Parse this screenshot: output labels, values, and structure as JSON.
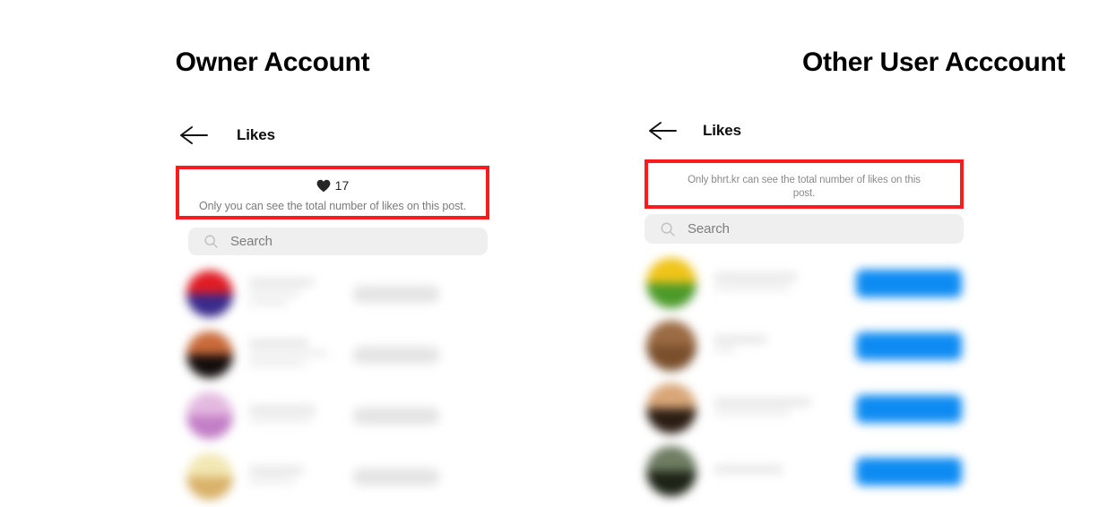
{
  "panels": [
    {
      "id": "owner",
      "section_title": "Owner Account",
      "nav": {
        "back_icon": "arrow-left-icon",
        "title": "Likes"
      },
      "highlight": {
        "heart_icon": "heart-filled-icon",
        "like_count": "17",
        "privacy_note": "Only you can see the total number of likes on this post.",
        "border_color": "#fb1b1b"
      },
      "search": {
        "icon": "search-icon",
        "placeholder": "Search",
        "value": ""
      },
      "action_button_style": "gray",
      "action_button_color": "#e4e4e4",
      "rows": [
        {
          "avatar_top": "#e01c24",
          "avatar_bottom": "#3a2a8c",
          "name_w": 72,
          "sub_w": 58,
          "sub2_w": 44
        },
        {
          "avatar_top": "#c96a3a",
          "avatar_bottom": "#140d0d",
          "name_w": 66,
          "sub_w": 88,
          "sub2_w": 62
        },
        {
          "avatar_top": "#e3b9e0",
          "avatar_bottom": "#c27ec6",
          "name_w": 74,
          "sub_w": 70,
          "sub2_w": 0
        },
        {
          "avatar_top": "#f2e8b4",
          "avatar_bottom": "#d9b26a",
          "name_w": 60,
          "sub_w": 50,
          "sub2_w": 0
        }
      ]
    },
    {
      "id": "other-user",
      "section_title": "Other User Acccount",
      "nav": {
        "back_icon": "arrow-left-icon",
        "title": "Likes"
      },
      "highlight": {
        "heart_icon": null,
        "like_count": null,
        "privacy_note": "Only bhrt.kr can see the total number of likes on this post.",
        "border_color": "#fb1b1b"
      },
      "search": {
        "icon": "search-icon",
        "placeholder": "Search",
        "value": ""
      },
      "action_button_style": "blue",
      "action_button_color": "#0d8bf2",
      "rows": [
        {
          "avatar_top": "#f0c419",
          "avatar_bottom": "#4c9a2a",
          "name_w": 92,
          "sub_w": 84,
          "sub2_w": 0
        },
        {
          "avatar_top": "#9b6b43",
          "avatar_bottom": "#7a4f2c",
          "name_w": 58,
          "sub_w": 22,
          "sub2_w": 0
        },
        {
          "avatar_top": "#d8a678",
          "avatar_bottom": "#2b1d13",
          "name_w": 108,
          "sub_w": 84,
          "sub2_w": 0
        },
        {
          "avatar_top": "#6f7d63",
          "avatar_bottom": "#1d2316",
          "name_w": 76,
          "sub_w": 0,
          "sub2_w": 0
        }
      ]
    }
  ]
}
